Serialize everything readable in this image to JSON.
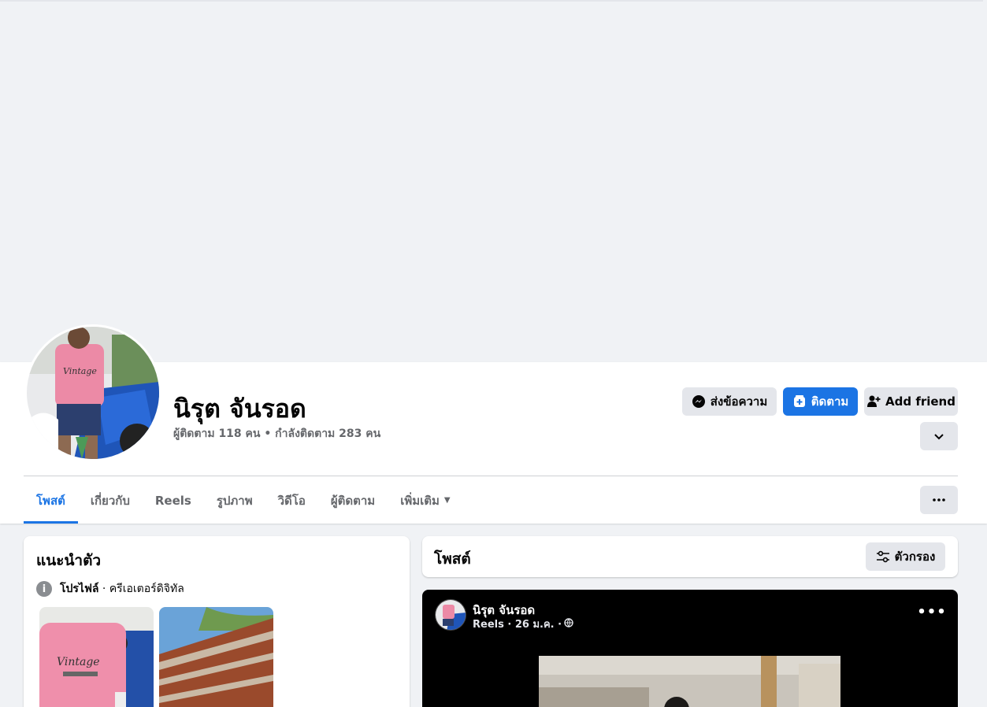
{
  "profile": {
    "name": "นิรุต จันรอด",
    "stats": "ผู้ติดตาม 118 คน • กำลังติดตาม 283 คน"
  },
  "actions": {
    "message_label": "ส่งข้อความ",
    "follow_label": "ติดตาม",
    "add_friend_label": "Add friend"
  },
  "tabs": [
    {
      "label": "โพสต์",
      "active": true
    },
    {
      "label": "เกี่ยวกับ",
      "active": false
    },
    {
      "label": "Reels",
      "active": false
    },
    {
      "label": "รูปภาพ",
      "active": false
    },
    {
      "label": "วิดีโอ",
      "active": false
    },
    {
      "label": "ผู้ติดตาม",
      "active": false
    },
    {
      "label": "เพิ่มเติม",
      "active": false
    }
  ],
  "intro": {
    "title": "แนะนำตัว",
    "category_label": "โปรไฟล์",
    "category_value": " · ครีเอเตอร์ดิจิทัล"
  },
  "posts": {
    "title": "โพสต์",
    "filter_label": "ตัวกรอง"
  },
  "post": {
    "author": "นิรุต จันรอด",
    "meta": "Reels · 26 ม.ค. ·"
  },
  "colors": {
    "accent": "#1b74e4",
    "page_bg": "#f0f2f5",
    "button_grey": "#e4e6eb"
  }
}
